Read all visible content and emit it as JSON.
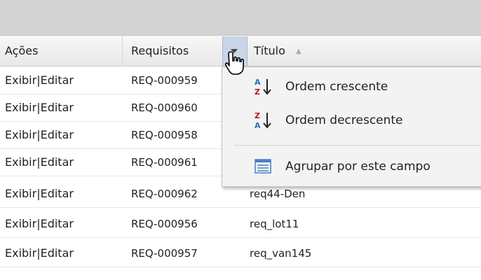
{
  "header": {
    "actions_label": "Ações",
    "requirements_label": "Requisitos",
    "title_label": "Título"
  },
  "rows": [
    {
      "view": "Exibir",
      "sep": "|",
      "edit": "Editar",
      "req": "REQ-000959",
      "title": ""
    },
    {
      "view": "Exibir",
      "sep": "|",
      "edit": "Editar",
      "req": "REQ-000960",
      "title": ""
    },
    {
      "view": "Exibir",
      "sep": "|",
      "edit": "Editar",
      "req": "REQ-000958",
      "title": ""
    },
    {
      "view": "Exibir",
      "sep": "|",
      "edit": "Editar",
      "req": "REQ-000961",
      "title": ""
    },
    {
      "view": "Exibir",
      "sep": "|",
      "edit": "Editar",
      "req": "REQ-000962",
      "title": "req44-Den"
    },
    {
      "view": "Exibir",
      "sep": "|",
      "edit": "Editar",
      "req": "REQ-000956",
      "title": "req_lot11"
    },
    {
      "view": "Exibir",
      "sep": "|",
      "edit": "Editar",
      "req": "REQ-000957",
      "title": "req_van145"
    }
  ],
  "menu": {
    "sort_asc": "Ordem crescente",
    "sort_desc": "Ordem decrescente",
    "group_by": "Agrupar por este campo"
  },
  "icons": {
    "column_dropdown": "chevron-down-icon",
    "cursor": "hand-pointer-icon",
    "sort_asc": "sort-ascending-icon",
    "sort_desc": "sort-descending-icon",
    "group_by": "group-by-icon"
  },
  "colors": {
    "toolbar": "#d3d3d3",
    "dropdown_trigger": "#c9d6e6",
    "menu_background": "#f3f3f3",
    "sort_letter_a": "#2a6ebb",
    "sort_letter_z": "#b01818"
  }
}
